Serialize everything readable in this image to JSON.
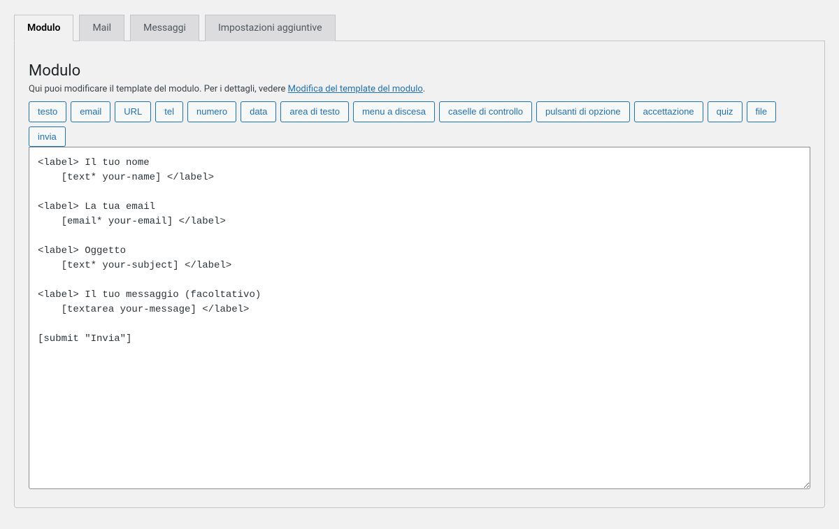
{
  "tabs": [
    {
      "id": "modulo",
      "label": "Modulo",
      "active": true
    },
    {
      "id": "mail",
      "label": "Mail",
      "active": false
    },
    {
      "id": "messaggi",
      "label": "Messaggi",
      "active": false
    },
    {
      "id": "impostazioni",
      "label": "Impostazioni aggiuntive",
      "active": false
    }
  ],
  "panel": {
    "heading": "Modulo",
    "desc_prefix": "Qui puoi modificare il template del modulo. Per i dettagli, vedere ",
    "desc_link": "Modifica del template del modulo",
    "desc_suffix": "."
  },
  "tag_buttons": [
    "testo",
    "email",
    "URL",
    "tel",
    "numero",
    "data",
    "area di testo",
    "menu a discesa",
    "caselle di controllo",
    "pulsanti di opzione",
    "accettazione",
    "quiz",
    "file",
    "invia"
  ],
  "form_template": "<label> Il tuo nome\n    [text* your-name] </label>\n\n<label> La tua email\n    [email* your-email] </label>\n\n<label> Oggetto\n    [text* your-subject] </label>\n\n<label> Il tuo messaggio (facoltativo)\n    [textarea your-message] </label>\n\n[submit \"Invia\"]"
}
